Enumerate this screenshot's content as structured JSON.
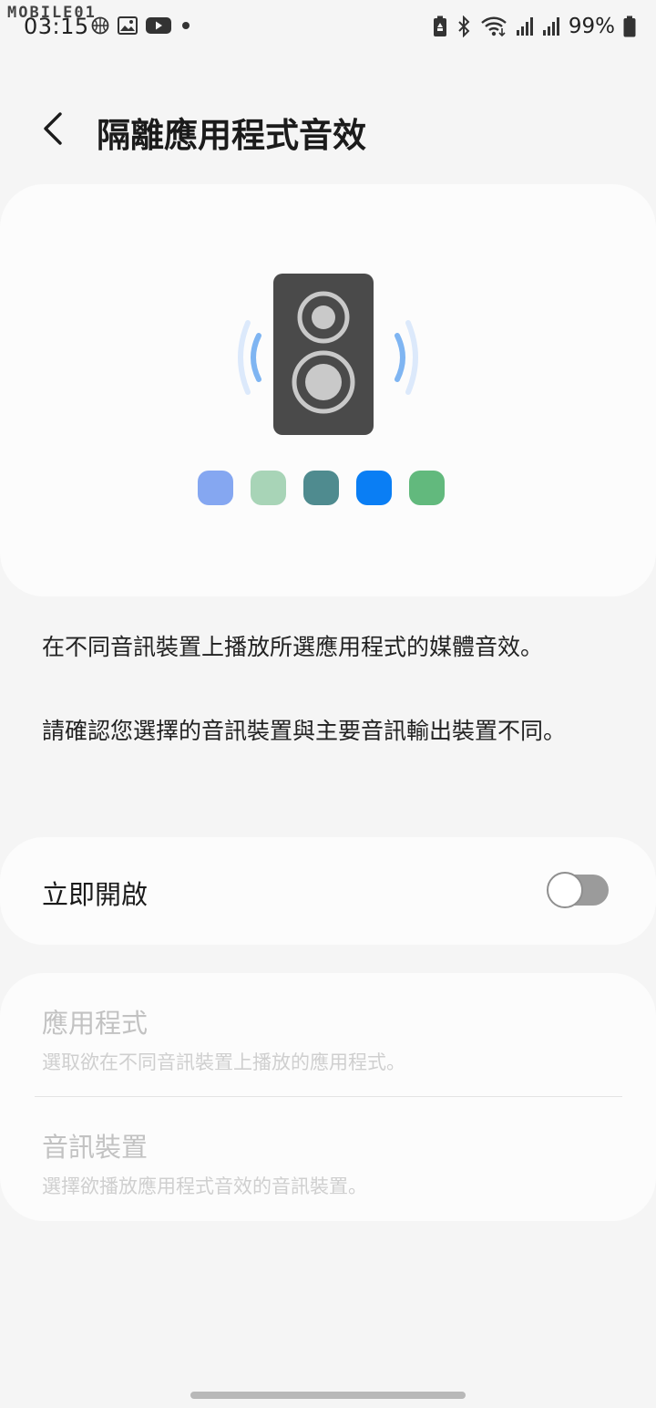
{
  "status_bar": {
    "time": "03:15",
    "battery_percent": "99%",
    "watermark": "MOBILE01",
    "left_icons": [
      "basketball-icon",
      "gallery-icon",
      "youtube-icon",
      "notification-dot-icon"
    ],
    "right_icons": [
      "battery-saver-icon",
      "bluetooth-icon",
      "wifi-icon",
      "signal-icon",
      "signal-icon",
      "battery-icon"
    ]
  },
  "header": {
    "back_icon": "chevron-left-icon",
    "title": "隔離應用程式音效"
  },
  "hero": {
    "illustration_icon": "speaker-icon",
    "swatch_colors": [
      "#85a7f1",
      "#a8d4b7",
      "#4f8b8f",
      "#0a7ef4",
      "#62b97d"
    ]
  },
  "description": {
    "paragraph_1": "在不同音訊裝置上播放所選應用程式的媒體音效。",
    "paragraph_2": "請確認您選擇的音訊裝置與主要音訊輸出裝置不同。"
  },
  "toggle": {
    "label": "立即開啟",
    "state": "off"
  },
  "options": [
    {
      "title": "應用程式",
      "subtitle": "選取欲在不同音訊裝置上播放的應用程式。",
      "enabled": false
    },
    {
      "title": "音訊裝置",
      "subtitle": "選擇欲播放應用程式音效的音訊裝置。",
      "enabled": false
    }
  ],
  "colors": {
    "background": "#f5f5f5",
    "card": "#fcfcfc",
    "speaker_body": "#4a4a4a",
    "sound_wave": "#7fb5f2",
    "disabled_text": "#c2c2c2"
  }
}
